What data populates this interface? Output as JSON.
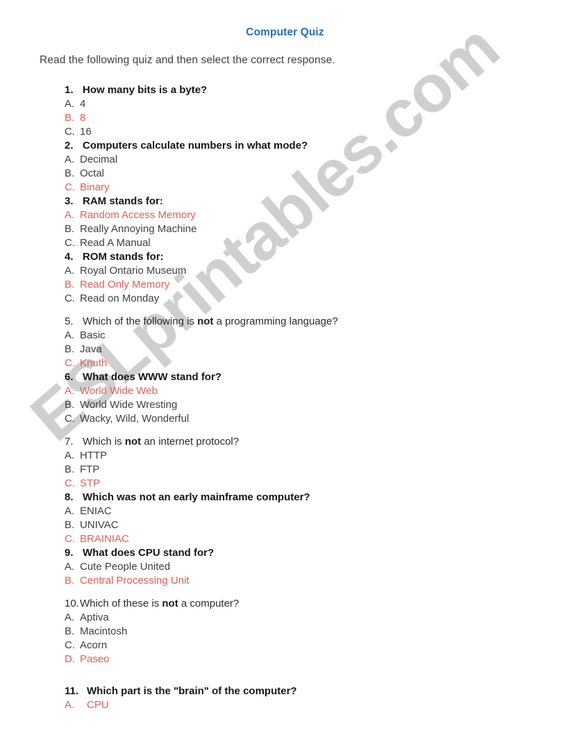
{
  "document": {
    "title": "Computer Quiz",
    "title_color": "#1f6fc4",
    "instructions": "Read the following quiz and then select the correct response.",
    "answer_color": "#ea5b52",
    "body_color": "#3f3f3f"
  },
  "watermark": {
    "text": "ESLprintables.com",
    "color": "#cfcfcf"
  },
  "quiz": {
    "questions": [
      {
        "number": "1.",
        "text": "How many bits is a byte?",
        "bold": true,
        "options": [
          {
            "letter": "A.",
            "text": "4",
            "answer": false
          },
          {
            "letter": "B.",
            "text": "8",
            "answer": true
          },
          {
            "letter": "C.",
            "text": "16",
            "answer": false
          }
        ]
      },
      {
        "number": "2.",
        "text": "Computers calculate numbers in what mode?",
        "bold": true,
        "options": [
          {
            "letter": "A.",
            "text": "Decimal",
            "answer": false
          },
          {
            "letter": "B.",
            "text": "Octal",
            "answer": false
          },
          {
            "letter": "C.",
            "text": "Binary",
            "answer": true
          }
        ]
      },
      {
        "number": "3.",
        "text": "RAM stands for:",
        "bold": true,
        "options": [
          {
            "letter": "A.",
            "text": "Random Access Memory",
            "answer": true
          },
          {
            "letter": "B.",
            "text": "Really Annoying Machine",
            "answer": false
          },
          {
            "letter": "C.",
            "text": "Read A Manual",
            "answer": false
          }
        ]
      },
      {
        "number": "4.",
        "text": "ROM stands for:",
        "bold": true,
        "options": [
          {
            "letter": "A.",
            "text": "Royal Ontario Museum",
            "answer": false
          },
          {
            "letter": "B.",
            "text": "Read Only Memory",
            "answer": true
          },
          {
            "letter": "C.",
            "text": "Read on Monday",
            "answer": false
          }
        ]
      },
      {
        "number": "5.",
        "text_before": "Which of the following is ",
        "emphasis": "not",
        "text_after": " a programming language?",
        "bold": false,
        "options": [
          {
            "letter": "A.",
            "text": "Basic",
            "answer": false
          },
          {
            "letter": "B.",
            "text": "Java",
            "answer": false
          },
          {
            "letter": "C.",
            "text": "Knuth",
            "answer": true
          }
        ]
      },
      {
        "number": "6.",
        "text": "What does WWW stand for?",
        "bold": true,
        "options": [
          {
            "letter": "A.",
            "text": "World Wide Web",
            "answer": true
          },
          {
            "letter": "B.",
            "text": "World Wide Wresting",
            "answer": false
          },
          {
            "letter": "C.",
            "text": "Wacky, Wild, Wonderful",
            "answer": false
          }
        ]
      },
      {
        "number": "7.",
        "text_before": "Which is ",
        "emphasis": "not",
        "text_after": " an internet protocol?",
        "bold": false,
        "options": [
          {
            "letter": "A.",
            "text": "HTTP",
            "answer": false
          },
          {
            "letter": "B.",
            "text": "FTP",
            "answer": false
          },
          {
            "letter": "C.",
            "text": "STP",
            "answer": true
          }
        ]
      },
      {
        "number": "8.",
        "text": "Which was not an early mainframe computer?",
        "bold": true,
        "options": [
          {
            "letter": "A.",
            "text": "ENIAC",
            "answer": false
          },
          {
            "letter": "B.",
            "text": "UNIVAC",
            "answer": false
          },
          {
            "letter": "C.",
            "text": "BRAINIAC",
            "answer": true
          }
        ]
      },
      {
        "number": "9.",
        "text": "What does CPU stand for?",
        "bold": true,
        "options": [
          {
            "letter": "A.",
            "text": "Cute People United",
            "answer": false
          },
          {
            "letter": "B.",
            "text": "Central Processing Unit",
            "answer": true
          }
        ]
      },
      {
        "number": "10.",
        "text_before": "Which of these is ",
        "emphasis": "not",
        "text_after": " a computer?",
        "bold": false,
        "options": [
          {
            "letter": "A.",
            "text": "Aptiva",
            "answer": false
          },
          {
            "letter": "B.",
            "text": "Macintosh",
            "answer": false
          },
          {
            "letter": "C.",
            "text": "Acorn",
            "answer": false
          },
          {
            "letter": "D.",
            "text": "Paseo",
            "answer": true
          }
        ]
      },
      {
        "number": "11.",
        "text": "Which part is the \"brain\" of the computer?",
        "bold": true,
        "options": [
          {
            "letter": "A.",
            "text": "CPU",
            "answer": true
          }
        ]
      }
    ]
  }
}
